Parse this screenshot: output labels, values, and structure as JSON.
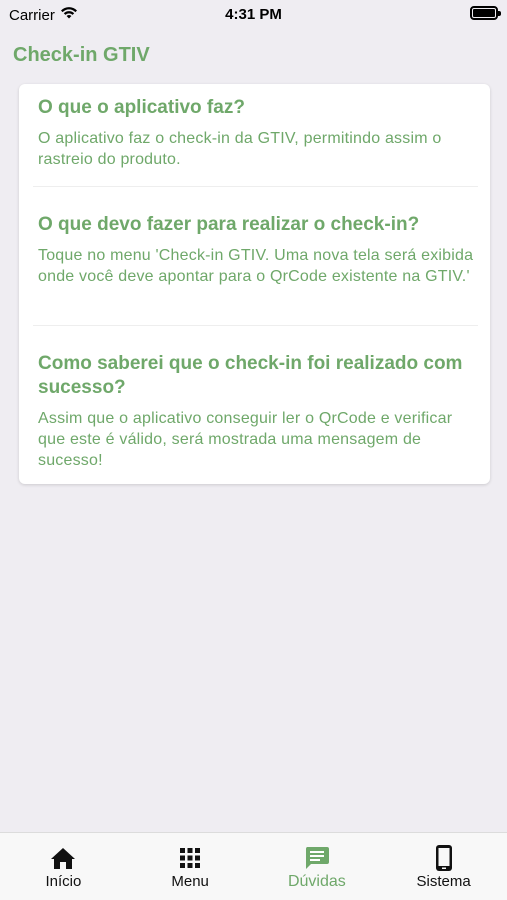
{
  "status_bar": {
    "carrier": "Carrier",
    "time": "4:31 PM",
    "wifi_icon": "wifi-icon",
    "battery_icon": "battery-icon"
  },
  "header": {
    "title": "Check-in GTIV"
  },
  "faq": [
    {
      "question": "O que o aplicativo faz?",
      "answer": "O aplicativo faz o check-in da GTIV, permitindo assim o rastreio do produto."
    },
    {
      "question": "O que devo fazer para realizar o check-in?",
      "answer": "Toque no menu 'Check-in GTIV. Uma nova tela será exibida onde você deve apontar para o QrCode existente na GTIV.'"
    },
    {
      "question": "Como saberei que o check-in foi realizado com sucesso?",
      "answer": "Assim que o aplicativo conseguir ler o QrCode e verificar que este é válido, será mostrada uma mensagem de sucesso!"
    }
  ],
  "tab_bar": {
    "tabs": [
      {
        "label": "Início",
        "icon": "home-icon"
      },
      {
        "label": "Menu",
        "icon": "grid-icon"
      },
      {
        "label": "Dúvidas",
        "icon": "chat-icon",
        "active": true
      },
      {
        "label": "Sistema",
        "icon": "phone-icon"
      }
    ]
  },
  "colors": {
    "accent": "#6fa86a",
    "background": "#efedf2",
    "card": "#ffffff"
  }
}
